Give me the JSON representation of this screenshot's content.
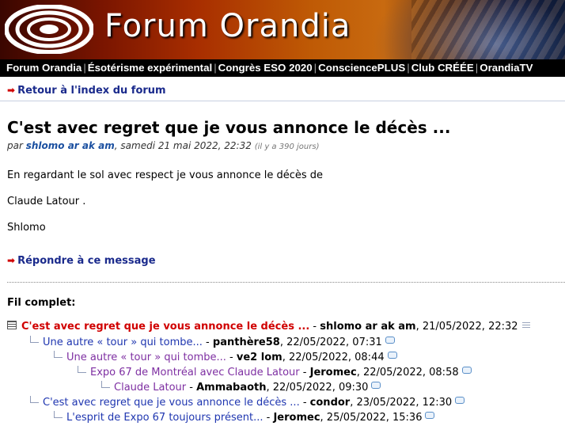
{
  "site": {
    "title": "Forum Orandia",
    "logo_icon": "orandia-spiral-logo"
  },
  "nav": {
    "items": [
      "Forum Orandia",
      "Ésotérisme expérimental",
      "Congrès ESO 2020",
      "ConsciencePLUS",
      "Club CRÉÉE",
      "OrandiaTV"
    ],
    "separator": "|"
  },
  "back_link": "Retour à l'index du forum",
  "message": {
    "title": "C'est avec regret que je vous annonce le décès ...",
    "by_prefix": "par",
    "author": "shlomo ar ak am",
    "date": ", samedi 21 mai 2022, 22:32",
    "ago": "(il y a 390 jours)",
    "paragraphs": [
      "En regardant le sol avec respect je vous annonce le décès de",
      "Claude Latour .",
      "Shlomo"
    ]
  },
  "reply_link": "Répondre à ce message",
  "thread": {
    "label": "Fil complet:",
    "posts": [
      {
        "title": "C'est avec regret que je vous annonce le décès ...",
        "author": "shlomo ar ak am",
        "date": ", 21/05/2022, 22:32",
        "depth": 0,
        "current": true
      },
      {
        "title": "Une autre « tour » qui tombe...",
        "author": "panthère58",
        "date": ", 22/05/2022, 07:31",
        "depth": 1
      },
      {
        "title": "Une autre « tour » qui tombe...",
        "author": "ve2 lom",
        "date": ", 22/05/2022, 08:44",
        "depth": 2
      },
      {
        "title": "Expo 67 de Montréal avec Claude Latour",
        "author": "Jeromec",
        "date": ", 22/05/2022, 08:58",
        "depth": 3
      },
      {
        "title": "Claude Latour",
        "author": "Ammabaoth",
        "date": ", 22/05/2022, 09:30",
        "depth": 4
      },
      {
        "title": "C'est avec regret que je vous annonce le décès ...",
        "author": "condor",
        "date": ", 23/05/2022, 12:30",
        "depth": 1
      },
      {
        "title": "L'esprit de Expo 67 toujours présent...",
        "author": "Jeromec",
        "date": ", 25/05/2022, 15:36",
        "depth": 2
      }
    ],
    "dash": " - "
  }
}
